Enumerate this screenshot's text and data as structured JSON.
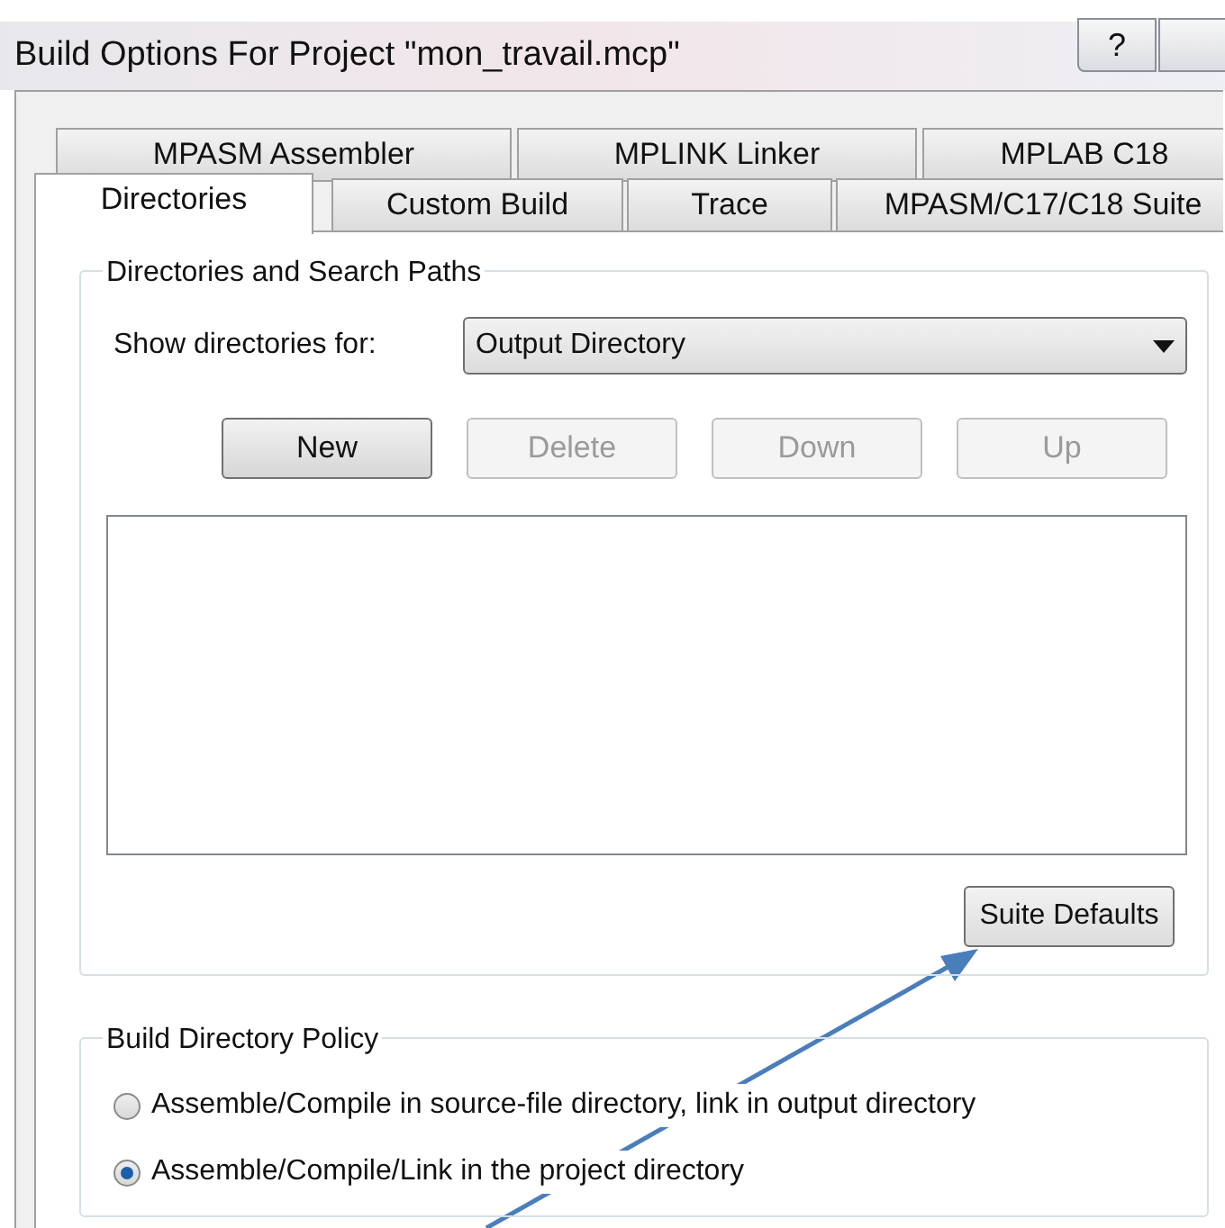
{
  "window": {
    "title": "Build Options For Project \"mon_travail.mcp\"",
    "help_button": "?"
  },
  "tab_rows": [
    [
      {
        "label": "MPASM Assembler",
        "selected": false
      },
      {
        "label": "MPLINK Linker",
        "selected": false
      },
      {
        "label": "MPLAB C18",
        "selected": false
      }
    ],
    [
      {
        "label": "Directories",
        "selected": true
      },
      {
        "label": "Custom Build",
        "selected": false
      },
      {
        "label": "Trace",
        "selected": false
      },
      {
        "label": "MPASM/C17/C18 Suite",
        "selected": false
      }
    ]
  ],
  "directories_group": {
    "legend": "Directories and Search Paths",
    "show_label": "Show directories for:",
    "dropdown_value": "Output Directory",
    "buttons": [
      {
        "label": "New",
        "disabled": false
      },
      {
        "label": "Delete",
        "disabled": true
      },
      {
        "label": "Down",
        "disabled": true
      },
      {
        "label": "Up",
        "disabled": true
      }
    ],
    "suite_defaults": "Suite Defaults"
  },
  "policy_group": {
    "legend": "Build Directory Policy",
    "options": [
      {
        "label": "Assemble/Compile in source-file directory, link in output directory",
        "selected": false
      },
      {
        "label": "Assemble/Compile/Link in the project directory",
        "selected": true
      }
    ]
  }
}
